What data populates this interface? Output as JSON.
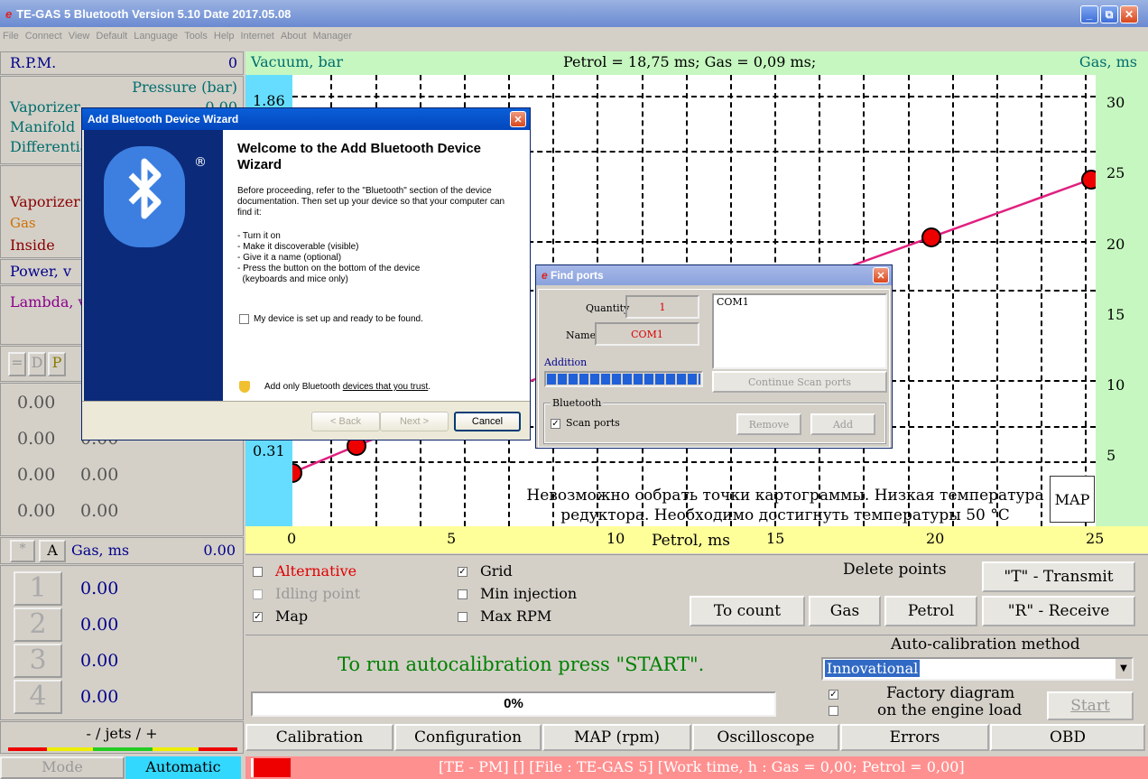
{
  "window": {
    "title": "TE-GAS 5 Bluetooth Version 5.10  Date 2017.05.08"
  },
  "menu": [
    "File",
    "Connect",
    "View",
    "Default",
    "Language",
    "Tools",
    "Help",
    "Internet",
    "About",
    "Manager"
  ],
  "left": {
    "rpm_label": "R.P.M.",
    "rpm_value": "0",
    "pressure_header": "Pressure (bar)",
    "vaporizer": "Vaporizer",
    "manifold": "Manifold",
    "differential": "Differential",
    "pressure_value": "0.00",
    "temp_vaporizer": "Vaporizer",
    "temp_gas": "Gas",
    "temp_inside": "Inside",
    "power": "Power, v",
    "lambda": "Lambda, v",
    "btn_eq": "=",
    "btn_d": "D",
    "btn_p": "P",
    "rows": [
      [
        "0.00",
        "0.00"
      ],
      [
        "0.00",
        "0.00"
      ],
      [
        "0.00",
        "0.00"
      ],
      [
        "0.00",
        "0.00"
      ]
    ],
    "star": "*",
    "a": "A",
    "gas_ms_label": "Gas, ms",
    "gas_ms_value": "0.00",
    "cylinders": [
      {
        "n": "1",
        "v": "0.00"
      },
      {
        "n": "2",
        "v": "0.00"
      },
      {
        "n": "3",
        "v": "0.00"
      },
      {
        "n": "4",
        "v": "0.00"
      }
    ],
    "jets": "- / jets / +",
    "mode": "Mode",
    "mode_value": "Automatic"
  },
  "chart_header": {
    "left": "Vacuum, bar",
    "center": "Petrol = 18,75 ms; Gas = 0,09 ms;",
    "right": "Gas, ms"
  },
  "chart_data": {
    "type": "line",
    "xlabel": "Petrol, ms",
    "x_ticks": [
      "0",
      "5",
      "10",
      "15",
      "20",
      "25"
    ],
    "y_right_ticks": [
      "30",
      "25",
      "20",
      "15",
      "10",
      "5"
    ],
    "y_left_ticks": [
      "1.86",
      "0.31"
    ],
    "xlim": [
      0,
      25
    ],
    "ylim": [
      0,
      32
    ],
    "series": [
      {
        "points": [
          [
            0,
            3.8
          ],
          [
            2,
            5.7
          ],
          [
            4,
            7.5
          ],
          [
            20,
            20.5
          ],
          [
            25,
            24.6
          ]
        ]
      }
    ],
    "line_color": "#e0207f"
  },
  "chart_msg": [
    "Невозможно собрать точки картограммы. Низкая температура",
    "редуктора. Необходимо достигнуть температуры 50 °C"
  ],
  "map_btn": "MAP",
  "options": {
    "alternative": "Alternative",
    "idling": "Idling point",
    "map": "Map",
    "grid": "Grid",
    "min_inj": "Min injection",
    "max_rpm": "Max RPM"
  },
  "delete_points": "Delete points",
  "buttons": {
    "to_count": "To count",
    "gas": "Gas",
    "petrol": "Petrol",
    "transmit": "\"T\" - Transmit",
    "receive": "\"R\" - Receive"
  },
  "autocal": {
    "msg": "To run autocalibration press \"START\".",
    "progress": "0%",
    "method_label": "Auto-calibration method",
    "method": "Innovational",
    "factory": "Factory diagram",
    "engine_load": "on the engine load",
    "start": "Start"
  },
  "tabs": [
    "Calibration",
    "Configuration",
    "MAP (rpm)",
    "Oscilloscope",
    "Errors",
    "OBD"
  ],
  "status": "[TE - PM] [] [File : TE-GAS 5] [Work time, h : Gas = 0,00; Petrol = 0,00]",
  "bt_wizard": {
    "title": "Add Bluetooth Device Wizard",
    "heading": "Welcome to the Add Bluetooth Device Wizard",
    "intro": "Before proceeding, refer to the \"Bluetooth\" section of the device documentation. Then set up your device so that your computer can find it:",
    "steps": [
      "- Turn it on",
      "- Make it discoverable (visible)",
      "- Give it a name (optional)",
      "- Press the button on the bottom of the device",
      "  (keyboards and mice only)"
    ],
    "ready": "My device is set up and ready to be found.",
    "trust_prefix": "Add only Bluetooth ",
    "trust_link": "devices that you trust",
    "back": "< Back",
    "next": "Next >",
    "cancel": "Cancel"
  },
  "find_ports": {
    "title": "Find ports",
    "quantity_label": "Quantity",
    "quantity": "1",
    "name_label": "Name",
    "name": "COM1",
    "list": [
      "COM1"
    ],
    "addition": "Addition",
    "continue": "Continue Scan ports",
    "bluetooth": "Bluetooth",
    "scan": "Scan ports",
    "remove": "Remove",
    "add": "Add"
  }
}
